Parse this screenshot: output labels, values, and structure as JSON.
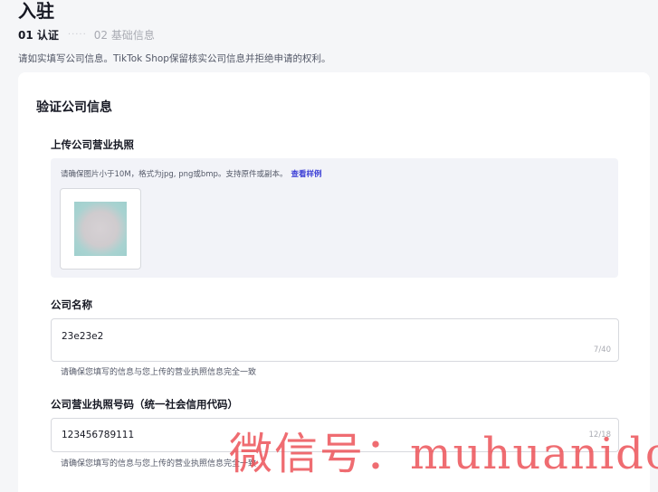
{
  "page": {
    "title": "入驻"
  },
  "steps": [
    {
      "label": "01 认证",
      "active": true
    },
    {
      "label": "02 基础信息",
      "active": false
    }
  ],
  "step_separator": "·····",
  "notice": "请如实填写公司信息。TikTok Shop保留核实公司信息并拒绝申请的权利。",
  "card": {
    "title": "验证公司信息"
  },
  "license_upload": {
    "label": "上传公司营业执照",
    "hint": "请确保图片小于10M，格式为jpg, png或bmp。支持原件或副本。",
    "example_link": "查看样例"
  },
  "company_name": {
    "label": "公司名称",
    "value": "23e23e2",
    "count": "7/40",
    "helper": "请确保您填写的信息与您上传的营业执照信息完全一致"
  },
  "license_number": {
    "label": "公司营业执照号码（统一社会信用代码）",
    "value": "123456789111",
    "count": "12/18",
    "helper": "请确保您填写的信息与您上传的营业执照信息完全一致"
  },
  "watermark": "微信号：muhuanidc",
  "colors": {
    "link": "#3c3fd6",
    "page_bg": "#f5f6f8",
    "upload_bg": "#f2f3f8",
    "watermark": "#ec5258"
  }
}
